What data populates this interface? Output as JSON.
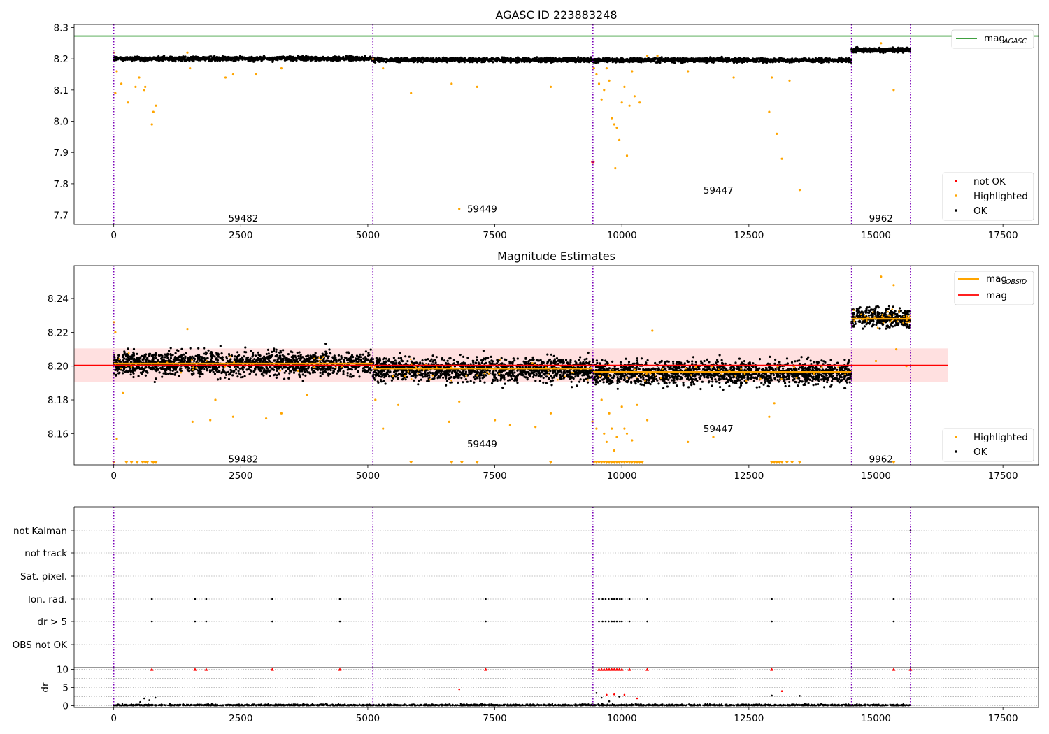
{
  "chart_data": [
    {
      "type": "scatter",
      "title": "AGASC ID 223883248",
      "xlim": [
        -780,
        18200
      ],
      "ylim": [
        7.67,
        8.31
      ],
      "xticks": [
        0,
        2500,
        5000,
        7500,
        10000,
        12500,
        15000,
        17500
      ],
      "yticks": [
        7.7,
        7.8,
        7.9,
        8.0,
        8.1,
        8.2,
        8.3
      ],
      "series": [
        {
          "name": "OK",
          "color": "#000000",
          "description": "dense band near mag 8.20 for samples 0-14520, near 8.23 for 14520-15680"
        },
        {
          "name": "Highlighted",
          "color": "#ffa500"
        },
        {
          "name": "not OK",
          "color": "#ff0000"
        }
      ],
      "ok_bands": [
        {
          "x": [
            0,
            5100
          ],
          "y": 8.201,
          "spread": 0.006
        },
        {
          "x": [
            5100,
            9430
          ],
          "y": 8.197,
          "spread": 0.006
        },
        {
          "x": [
            9430,
            14520
          ],
          "y": 8.196,
          "spread": 0.006
        },
        {
          "x": [
            14520,
            15680
          ],
          "y": 8.228,
          "spread": 0.006
        }
      ],
      "highlighted_points": [
        [
          0,
          8.22
        ],
        [
          30,
          8.09
        ],
        [
          60,
          8.16
        ],
        [
          150,
          8.12
        ],
        [
          280,
          8.06
        ],
        [
          430,
          8.11
        ],
        [
          500,
          8.14
        ],
        [
          600,
          8.1
        ],
        [
          620,
          8.11
        ],
        [
          750,
          7.99
        ],
        [
          780,
          8.03
        ],
        [
          830,
          8.05
        ],
        [
          1450,
          8.22
        ],
        [
          1500,
          8.17
        ],
        [
          2200,
          8.14
        ],
        [
          2350,
          8.15
        ],
        [
          2800,
          8.15
        ],
        [
          3300,
          8.17
        ],
        [
          5100,
          8.2
        ],
        [
          5300,
          8.17
        ],
        [
          5850,
          8.09
        ],
        [
          6650,
          8.12
        ],
        [
          6800,
          7.72
        ],
        [
          7150,
          8.11
        ],
        [
          8600,
          8.11
        ],
        [
          9450,
          8.17
        ],
        [
          9500,
          8.15
        ],
        [
          9550,
          8.12
        ],
        [
          9600,
          8.07
        ],
        [
          9650,
          8.1
        ],
        [
          9700,
          8.17
        ],
        [
          9750,
          8.13
        ],
        [
          9800,
          8.01
        ],
        [
          9850,
          7.99
        ],
        [
          9870,
          7.85
        ],
        [
          9900,
          7.98
        ],
        [
          9950,
          7.94
        ],
        [
          10000,
          8.06
        ],
        [
          10050,
          8.11
        ],
        [
          10100,
          7.89
        ],
        [
          10150,
          8.05
        ],
        [
          10200,
          8.16
        ],
        [
          10250,
          8.08
        ],
        [
          10350,
          8.06
        ],
        [
          10500,
          8.21
        ],
        [
          10700,
          8.21
        ],
        [
          11300,
          8.16
        ],
        [
          12200,
          8.14
        ],
        [
          12900,
          8.03
        ],
        [
          12950,
          8.14
        ],
        [
          13050,
          7.96
        ],
        [
          13150,
          7.88
        ],
        [
          13300,
          8.13
        ],
        [
          13500,
          7.78
        ],
        [
          15350,
          8.1
        ],
        [
          15100,
          8.25
        ]
      ],
      "notok_points": [
        [
          9420,
          7.87
        ],
        [
          9440,
          7.87
        ]
      ],
      "hlines": [
        {
          "name": "mag_AGASC",
          "y": 8.273,
          "color": "#008000"
        }
      ],
      "vlines": [
        0,
        5100,
        9430,
        14520,
        15680
      ],
      "obs_labels": [
        {
          "text": "59482",
          "x": 2550,
          "y": 7.69
        },
        {
          "text": "59449",
          "x": 7250,
          "y": 7.72
        },
        {
          "text": "59447",
          "x": 11900,
          "y": 7.78
        },
        {
          "text": "9962",
          "x": 15100,
          "y": 7.69
        }
      ],
      "legend": {
        "position": "lower-right",
        "entries": [
          "not OK",
          "Highlighted",
          "OK"
        ]
      },
      "legend_top": {
        "position": "upper-right",
        "main": "mag",
        "sub": "AGASC"
      }
    },
    {
      "type": "scatter",
      "title": "Magnitude Estimates",
      "xlim": [
        -780,
        18200
      ],
      "ylim": [
        8.1415,
        8.2595
      ],
      "xticks": [
        0,
        2500,
        5000,
        7500,
        10000,
        12500,
        15000,
        17500
      ],
      "yticks": [
        8.16,
        8.18,
        8.2,
        8.22,
        8.24
      ],
      "ytick_format": 2,
      "ok_bands": [
        {
          "x": [
            0,
            5100
          ],
          "y": 8.2015,
          "spread": 0.0065
        },
        {
          "x": [
            5100,
            9430
          ],
          "y": 8.198,
          "spread": 0.0065
        },
        {
          "x": [
            9430,
            14520
          ],
          "y": 8.196,
          "spread": 0.0065
        },
        {
          "x": [
            14520,
            15680
          ],
          "y": 8.229,
          "spread": 0.0055
        }
      ],
      "hlines": [
        {
          "name": "mag",
          "y": 8.2005,
          "x": [
            -780,
            16420
          ],
          "color": "#ff0000"
        }
      ],
      "band": {
        "y": [
          8.1905,
          8.2105
        ],
        "x": [
          -780,
          16420
        ],
        "color": "#ffe0e0"
      },
      "obsid_segments": [
        {
          "x": [
            0,
            5100
          ],
          "y": 8.2015
        },
        {
          "x": [
            5100,
            9430
          ],
          "y": 8.1985
        },
        {
          "x": [
            9430,
            14520
          ],
          "y": 8.1965
        },
        {
          "x": [
            14520,
            15680
          ],
          "y": 8.228
        }
      ],
      "highlighted_points": [
        [
          0,
          8.226
        ],
        [
          30,
          8.22
        ],
        [
          60,
          8.157
        ],
        [
          180,
          8.184
        ],
        [
          1450,
          8.222
        ],
        [
          1550,
          8.167
        ],
        [
          1900,
          8.168
        ],
        [
          2000,
          8.18
        ],
        [
          2350,
          8.17
        ],
        [
          3000,
          8.169
        ],
        [
          3300,
          8.172
        ],
        [
          3800,
          8.183
        ],
        [
          5150,
          8.18
        ],
        [
          5300,
          8.163
        ],
        [
          5600,
          8.177
        ],
        [
          6600,
          8.167
        ],
        [
          6800,
          8.179
        ],
        [
          7500,
          8.168
        ],
        [
          7800,
          8.165
        ],
        [
          8300,
          8.164
        ],
        [
          8600,
          8.172
        ],
        [
          9420,
          8.167
        ],
        [
          9500,
          8.163
        ],
        [
          9600,
          8.18
        ],
        [
          9650,
          8.16
        ],
        [
          9700,
          8.155
        ],
        [
          9750,
          8.172
        ],
        [
          9800,
          8.163
        ],
        [
          9850,
          8.15
        ],
        [
          9900,
          8.158
        ],
        [
          10000,
          8.176
        ],
        [
          10050,
          8.163
        ],
        [
          10100,
          8.16
        ],
        [
          10200,
          8.156
        ],
        [
          10300,
          8.177
        ],
        [
          10500,
          8.168
        ],
        [
          10600,
          8.221
        ],
        [
          11300,
          8.155
        ],
        [
          11800,
          8.158
        ],
        [
          12900,
          8.17
        ],
        [
          13000,
          8.178
        ],
        [
          15000,
          8.203
        ],
        [
          15100,
          8.253
        ],
        [
          15350,
          8.248
        ],
        [
          15400,
          8.21
        ],
        [
          15600,
          8.2
        ]
      ],
      "highlighted_floor": [
        0,
        250,
        350,
        460,
        570,
        620,
        660,
        760,
        780,
        810,
        830,
        5850,
        6650,
        6850,
        7150,
        8600,
        9450,
        9500,
        9550,
        9600,
        9650,
        9700,
        9750,
        9800,
        9850,
        9900,
        9950,
        10000,
        10050,
        10100,
        10150,
        10200,
        10250,
        10300,
        10350,
        10400,
        12950,
        13000,
        13050,
        13100,
        13150,
        13250,
        13350,
        13500,
        15350
      ],
      "vlines": [
        0,
        5100,
        9430,
        14520,
        15680
      ],
      "obs_labels": [
        {
          "text": "59482",
          "x": 2550,
          "y": 8.145
        },
        {
          "text": "59449",
          "x": 7250,
          "y": 8.154
        },
        {
          "text": "59447",
          "x": 11900,
          "y": 8.163
        },
        {
          "text": "9962",
          "x": 15100,
          "y": 8.145
        }
      ],
      "legend": {
        "position": "lower-right",
        "entries": [
          "Highlighted",
          "OK"
        ]
      },
      "legend_top": {
        "position": "upper-right",
        "entries": [
          {
            "main": "mag",
            "sub": "OBSID",
            "color": "#ffa500"
          },
          {
            "main": "mag",
            "color": "#ff0000"
          }
        ]
      }
    },
    {
      "type": "scatter",
      "title": "",
      "xlim": [
        -780,
        18200
      ],
      "categories": [
        "not Kalman",
        "not track",
        "Sat. pixel.",
        "Ion. rad.",
        "dr > 5",
        "OBS not OK"
      ],
      "flag_x": {
        "Ion. rad.": [
          750,
          1600,
          1820,
          3120,
          4450,
          7320,
          9550,
          9620,
          9680,
          9740,
          9800,
          9850,
          9900,
          9960,
          10000,
          10150,
          10500,
          12950,
          15350
        ],
        "dr > 5": [
          750,
          1600,
          1820,
          3120,
          4450,
          7320,
          9550,
          9620,
          9680,
          9740,
          9800,
          9850,
          9900,
          9960,
          10000,
          10150,
          10500,
          12950,
          15350
        ],
        "not Kalman": [
          15680
        ]
      },
      "vlines": [
        0,
        5100,
        9430,
        14520,
        15680
      ]
    },
    {
      "type": "scatter",
      "title": "",
      "ylabel": "dr",
      "xlim": [
        -780,
        18200
      ],
      "ylim": [
        -0.5,
        10.5
      ],
      "xticks": [
        0,
        2500,
        5000,
        7500,
        10000,
        12500,
        15000,
        17500
      ],
      "yticks": [
        0,
        5,
        10
      ],
      "clip_markers_x": [
        750,
        1600,
        1820,
        3120,
        4450,
        7320,
        9550,
        9600,
        9650,
        9700,
        9750,
        9800,
        9850,
        9900,
        9950,
        10000,
        10150,
        10500,
        12950,
        15350,
        15680
      ],
      "outliers": [
        [
          6800,
          4.5
        ],
        [
          9500,
          3.5
        ],
        [
          9600,
          2.2
        ],
        [
          9700,
          3.0
        ],
        [
          9850,
          3.1
        ],
        [
          9950,
          2.5
        ],
        [
          10050,
          3.0
        ],
        [
          13150,
          4.0
        ],
        [
          12950,
          2.8
        ],
        [
          13500,
          2.7
        ],
        [
          520,
          1.0
        ],
        [
          600,
          2.0
        ],
        [
          700,
          1.5
        ],
        [
          820,
          2.2
        ],
        [
          10300,
          2.0
        ],
        [
          9750,
          1.2
        ]
      ],
      "vlines": [
        0,
        5100,
        9430,
        14520,
        15680
      ]
    }
  ]
}
